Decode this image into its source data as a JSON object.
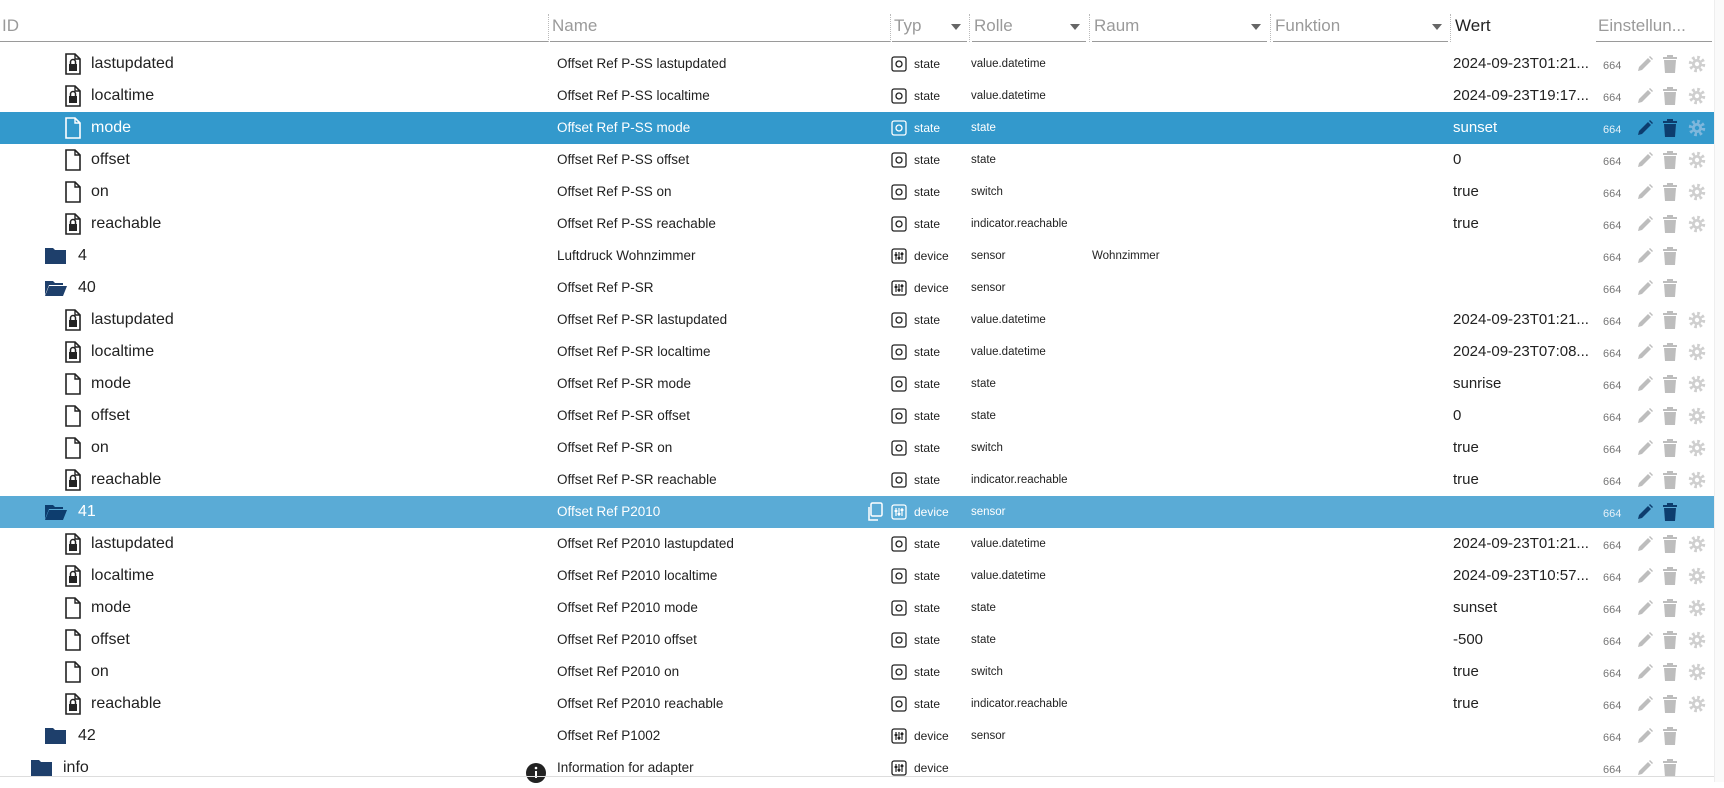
{
  "header": {
    "id_label": "ID",
    "name_label": "Name",
    "typ_label": "Typ",
    "rolle_label": "Rolle",
    "raum_label": "Raum",
    "funktion_label": "Funktion",
    "wert_label": "Wert",
    "einstellungen_label": "Einstellun..."
  },
  "colors": {
    "selected_row": "#3399cc",
    "selected_row_alt": "#5aabd6",
    "folder": "#1e3f6b"
  },
  "rows": [
    {
      "icon": "lock-file-icon",
      "id": "lastupdated",
      "name": "Offset Ref P-SS lastupdated",
      "typ": "state",
      "rolle": "value.datetime",
      "raum": "",
      "wert": "2024-09-23T01:21...",
      "acl": "664"
    },
    {
      "icon": "lock-file-icon",
      "id": "localtime",
      "name": "Offset Ref P-SS localtime",
      "typ": "state",
      "rolle": "value.datetime",
      "raum": "",
      "wert": "2024-09-23T19:17...",
      "acl": "664"
    },
    {
      "icon": "file-icon",
      "id": "mode",
      "name": "Offset Ref P-SS mode",
      "typ": "state",
      "rolle": "state",
      "raum": "",
      "wert": "sunset",
      "acl": "664",
      "selected": true
    },
    {
      "icon": "file-icon",
      "id": "offset",
      "name": "Offset Ref P-SS offset",
      "typ": "state",
      "rolle": "state",
      "raum": "",
      "wert": "0",
      "acl": "664"
    },
    {
      "icon": "file-icon",
      "id": "on",
      "name": "Offset Ref P-SS on",
      "typ": "state",
      "rolle": "switch",
      "raum": "",
      "wert": "true",
      "acl": "664"
    },
    {
      "icon": "lock-file-icon",
      "id": "reachable",
      "name": "Offset Ref P-SS reachable",
      "typ": "state",
      "rolle": "indicator.reachable",
      "raum": "",
      "wert": "true",
      "acl": "664"
    },
    {
      "icon": "folder-icon",
      "id": "4",
      "name": "Luftdruck Wohnzimmer",
      "typ": "device",
      "rolle": "sensor",
      "raum": "Wohnzimmer",
      "wert": "",
      "acl": "664"
    },
    {
      "icon": "folder-open-icon",
      "id": "40",
      "name": "Offset Ref P-SR",
      "typ": "device",
      "rolle": "sensor",
      "raum": "",
      "wert": "",
      "acl": "664"
    },
    {
      "icon": "lock-file-icon",
      "id": "lastupdated",
      "name": "Offset Ref P-SR lastupdated",
      "typ": "state",
      "rolle": "value.datetime",
      "raum": "",
      "wert": "2024-09-23T01:21...",
      "acl": "664"
    },
    {
      "icon": "lock-file-icon",
      "id": "localtime",
      "name": "Offset Ref P-SR localtime",
      "typ": "state",
      "rolle": "value.datetime",
      "raum": "",
      "wert": "2024-09-23T07:08...",
      "acl": "664"
    },
    {
      "icon": "file-icon",
      "id": "mode",
      "name": "Offset Ref P-SR mode",
      "typ": "state",
      "rolle": "state",
      "raum": "",
      "wert": "sunrise",
      "acl": "664"
    },
    {
      "icon": "file-icon",
      "id": "offset",
      "name": "Offset Ref P-SR offset",
      "typ": "state",
      "rolle": "state",
      "raum": "",
      "wert": "0",
      "acl": "664"
    },
    {
      "icon": "file-icon",
      "id": "on",
      "name": "Offset Ref P-SR on",
      "typ": "state",
      "rolle": "switch",
      "raum": "",
      "wert": "true",
      "acl": "664"
    },
    {
      "icon": "lock-file-icon",
      "id": "reachable",
      "name": "Offset Ref P-SR reachable",
      "typ": "state",
      "rolle": "indicator.reachable",
      "raum": "",
      "wert": "true",
      "acl": "664"
    },
    {
      "icon": "folder-open-icon",
      "id": "41",
      "name": "Offset Ref P2010",
      "typ": "device",
      "rolle": "sensor",
      "raum": "",
      "wert": "",
      "acl": "664",
      "selected2": true
    },
    {
      "icon": "lock-file-icon",
      "id": "lastupdated",
      "name": "Offset Ref P2010 lastupdated",
      "typ": "state",
      "rolle": "value.datetime",
      "raum": "",
      "wert": "2024-09-23T01:21...",
      "acl": "664"
    },
    {
      "icon": "lock-file-icon",
      "id": "localtime",
      "name": "Offset Ref P2010 localtime",
      "typ": "state",
      "rolle": "value.datetime",
      "raum": "",
      "wert": "2024-09-23T10:57...",
      "acl": "664"
    },
    {
      "icon": "file-icon",
      "id": "mode",
      "name": "Offset Ref P2010 mode",
      "typ": "state",
      "rolle": "state",
      "raum": "",
      "wert": "sunset",
      "acl": "664"
    },
    {
      "icon": "file-icon",
      "id": "offset",
      "name": "Offset Ref P2010 offset",
      "typ": "state",
      "rolle": "state",
      "raum": "",
      "wert": "-500",
      "acl": "664"
    },
    {
      "icon": "file-icon",
      "id": "on",
      "name": "Offset Ref P2010 on",
      "typ": "state",
      "rolle": "switch",
      "raum": "",
      "wert": "true",
      "acl": "664"
    },
    {
      "icon": "lock-file-icon",
      "id": "reachable",
      "name": "Offset Ref P2010 reachable",
      "typ": "state",
      "rolle": "indicator.reachable",
      "raum": "",
      "wert": "true",
      "acl": "664"
    },
    {
      "icon": "folder-icon",
      "id": "42",
      "name": "Offset Ref P1002",
      "typ": "device",
      "rolle": "sensor",
      "raum": "",
      "wert": "",
      "acl": "664"
    },
    {
      "icon": "folder-icon",
      "id": "info",
      "name": "Information for adapter",
      "typ": "device",
      "rolle": "",
      "raum": "",
      "wert": "",
      "acl": "664",
      "info": true
    }
  ]
}
